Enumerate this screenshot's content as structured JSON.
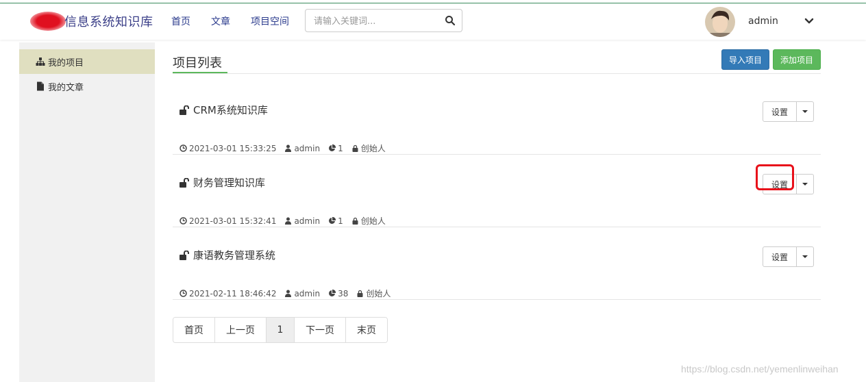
{
  "brand": {
    "title": "信息系统知识库"
  },
  "nav": {
    "items": [
      "首页",
      "文章",
      "项目空间"
    ]
  },
  "search": {
    "placeholder": "请输入关键词..."
  },
  "user": {
    "name": "admin"
  },
  "sidebar": {
    "items": [
      {
        "label": "我的项目",
        "icon": "sitemap-icon",
        "active": true
      },
      {
        "label": "我的文章",
        "icon": "file-icon",
        "active": false
      }
    ]
  },
  "main": {
    "title": "项目列表",
    "import_label": "导入项目",
    "add_label": "添加项目",
    "projects": [
      {
        "name": "CRM系统知识库",
        "date": "2021-03-01 15:33:25",
        "author": "admin",
        "count": "1",
        "role": "创始人",
        "setting": "设置"
      },
      {
        "name": "财务管理知识库",
        "date": "2021-03-01 15:32:41",
        "author": "admin",
        "count": "1",
        "role": "创始人",
        "setting": "设置"
      },
      {
        "name": "康语教务管理系统",
        "date": "2021-02-11 18:46:42",
        "author": "admin",
        "count": "38",
        "role": "创始人",
        "setting": "设置"
      }
    ]
  },
  "pagination": {
    "first": "首页",
    "prev": "上一页",
    "current": "1",
    "next": "下一页",
    "last": "末页"
  },
  "watermark": "https://blog.csdn.net/yemenlinweihan",
  "colors": {
    "accent_green": "#5cb85c",
    "primary_blue": "#337ab7",
    "highlight_red": "#e8101a",
    "sidebar_active": "#e0dfc0"
  }
}
